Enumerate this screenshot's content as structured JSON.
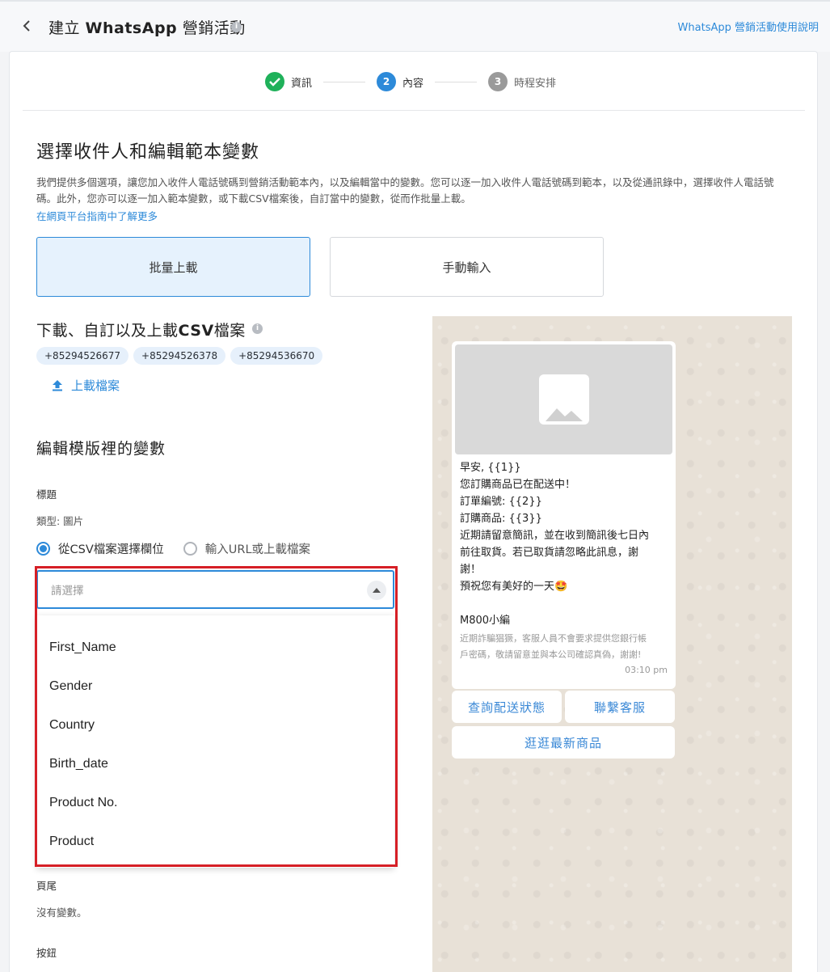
{
  "header": {
    "title_prefix": "建立 ",
    "title_bold": "WhatsApp",
    "title_suffix": " 營銷活動",
    "help_link": "WhatsApp 營銷活動使用說明"
  },
  "stepper": {
    "steps": [
      {
        "label": "資訊",
        "number": "",
        "state": "done"
      },
      {
        "label": "內容",
        "number": "2",
        "state": "active"
      },
      {
        "label": "時程安排",
        "number": "3",
        "state": "pending"
      }
    ]
  },
  "main": {
    "section_title": "選擇收件人和編輯範本變數",
    "description": "我們提供多個選項，讓您加入收件人電話號碼到營銷活動範本內，以及編輯當中的變數。您可以逐一加入收件人電話號碼到範本，以及從通訊錄中，選擇收件人電話號碼。此外，您亦可以逐一加入範本變數，或下載CSV檔案後，自訂當中的變數，從而作批量上載。",
    "learn_more": "在網頁平台指南中了解更多",
    "options": {
      "bulk": "批量上載",
      "manual": "手動輸入"
    },
    "csv_title_prefix": "下載、自訂以及上載",
    "csv_title_bold": "CSV",
    "csv_title_suffix": "檔案",
    "phone_chips": [
      "+85294526677",
      "+85294526378",
      "+85294536670"
    ],
    "upload_label": "上載檔案",
    "vars_title": "編輯模版裡的變數",
    "header_label": "標題",
    "type_label": "類型: 圖片",
    "radio_csv": "從CSV檔案選擇欄位",
    "radio_url": "輸入URL或上載檔案",
    "select_placeholder": "請選擇",
    "dropdown_options": [
      "First_Name",
      "Gender",
      "Country",
      "Birth_date",
      "Product No.",
      "Product"
    ],
    "footer_label": "頁尾",
    "footer_value": "沒有變數。",
    "buttons_label": "按鈕"
  },
  "preview": {
    "lines": [
      "早安, {{1}}",
      "您訂購商品已在配送中！",
      "訂單編號: {{2}}",
      "訂購商品: {{3}}",
      "近期請留意簡訊，並在收到簡訊後七日內",
      "前往取貨。若已取貨請忽略此訊息，謝",
      "謝！",
      "預祝您有美好的一天🤩"
    ],
    "signature": "M800小編",
    "footer_lines": [
      "近期詐騙猖獗，客服人員不會要求提供您銀行帳",
      "戶密碼，敬請留意並與本公司確認真偽，謝謝!"
    ],
    "time": "03:10 pm",
    "buttons": [
      "查詢配送狀態",
      "聯繫客服",
      "逛逛最新商品"
    ]
  },
  "colors": {
    "accent": "#2d8ad9",
    "success": "#1fb15a",
    "highlight": "#d61f26"
  }
}
